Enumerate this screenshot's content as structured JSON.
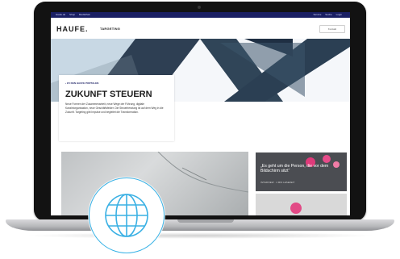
{
  "site": {
    "topbar_left": [
      "Haufe.de",
      "Shop",
      "Mediathek"
    ],
    "topbar_right": [
      "Service",
      "Suche",
      "Login"
    ],
    "logo_text": "HAUFE.",
    "nav_item": "TARGETING",
    "nav_button": "Kontakt"
  },
  "hero": {
    "back_link": "‹ ZU DEN HAUFE PORTALEN",
    "title": "ZUKUNFT STEUERN",
    "text": "Neue Formen der Zusammenarbeit, neue Wege der Führung, digitale Kanzleiorganisation, neue Geschäftsfelder. Die Steuerberatung ist auf dem Weg in die Zukunft. Targeting gibt Impulse und begleitet die Transformation."
  },
  "side_card": {
    "quote": "„Es geht um die Person, die vor dem Bildschirm sitzt“",
    "meta": "INTERVIEW · 4 MIN LESEZEIT"
  },
  "colors": {
    "brand_navy": "#1a1f63",
    "accent_blue": "#3bb3e6"
  },
  "icons": {
    "badge": "globe-icon"
  }
}
